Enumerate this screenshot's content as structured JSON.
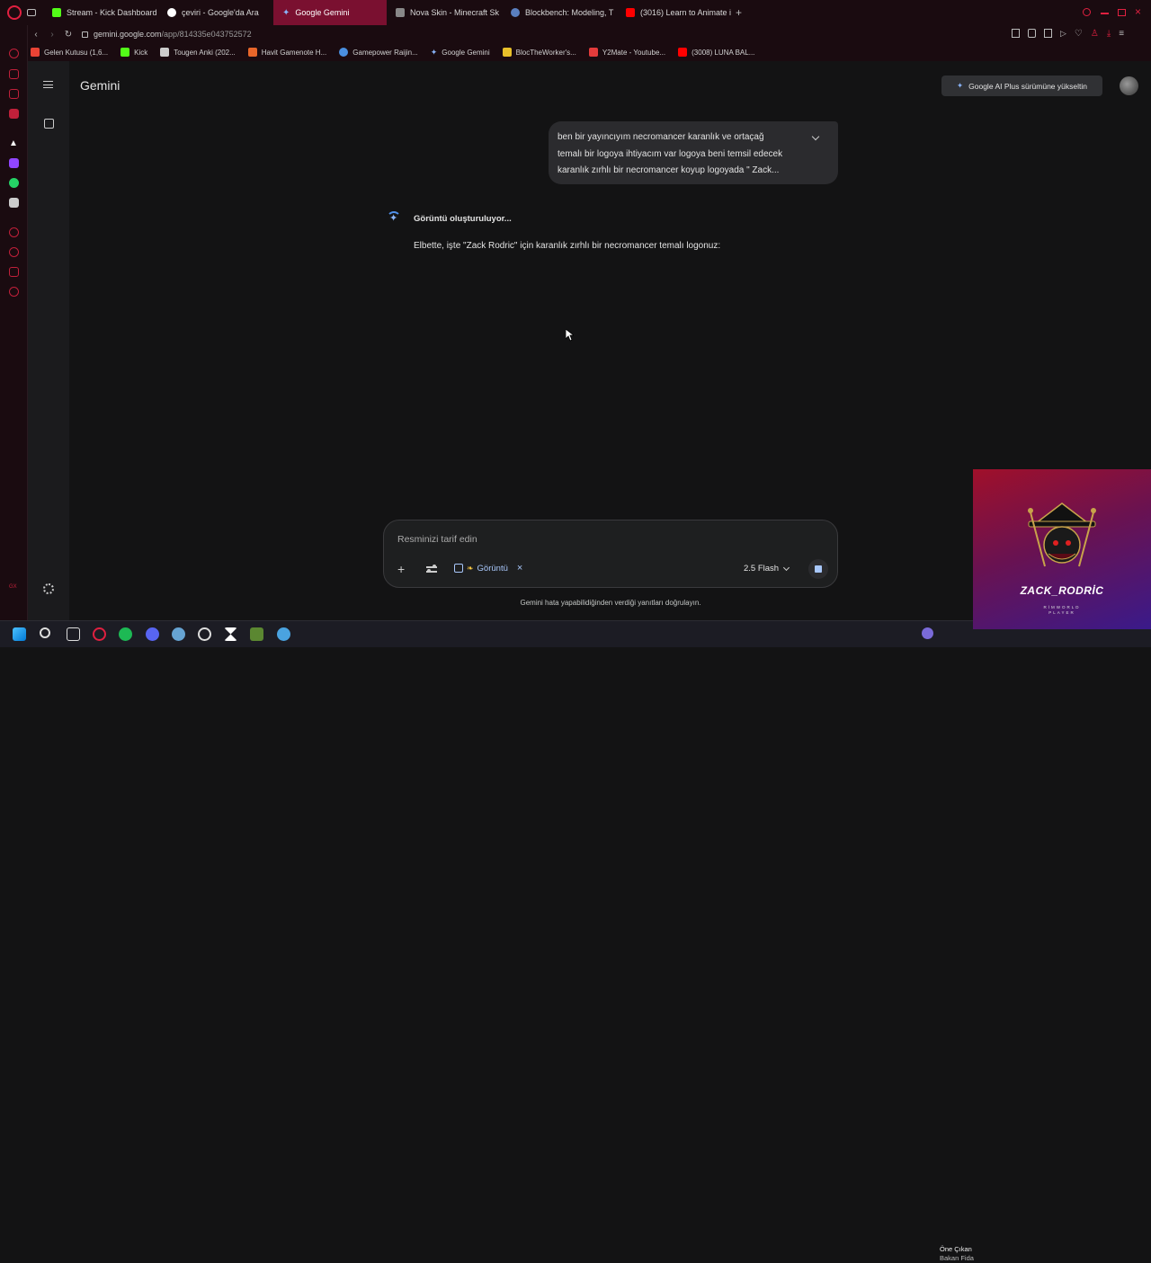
{
  "browser": {
    "tabs": [
      {
        "label": "Stream - Kick Dashboard",
        "color": "#53fc18"
      },
      {
        "label": "çeviri - Google'da Ara",
        "color": "#4285f4"
      },
      {
        "label": "Google Gemini",
        "color": "#8ab4f8",
        "active": true
      },
      {
        "label": "Nova Skin - Minecraft Sk",
        "color": "#888888"
      },
      {
        "label": "Blockbench: Modeling, T",
        "color": "#5a7fbf"
      },
      {
        "label": "(3016) Learn to Animate i",
        "color": "#ff0000"
      }
    ],
    "url_host": "gemini.google.com",
    "url_path": "/app/814335e043752572",
    "bookmarks": [
      {
        "label": "Gelen Kutusu (1,6...",
        "color": "#ea4335"
      },
      {
        "label": "Kick",
        "color": "#53fc18"
      },
      {
        "label": "Tougen Anki (202...",
        "color": "#cccccc"
      },
      {
        "label": "Havit Gamenote H...",
        "color": "#e8662a"
      },
      {
        "label": "Gamepower Raijin...",
        "color": "#4a8fe0"
      },
      {
        "label": "Google Gemini",
        "color": "#8ab4f8"
      },
      {
        "label": "BlocTheWorker's...",
        "color": "#e8c02a"
      },
      {
        "label": "Y2Mate - Youtube...",
        "color": "#e33b3b"
      },
      {
        "label": "(3008) LUNA BAL...",
        "color": "#ff0000"
      }
    ],
    "accent": "#7a1030"
  },
  "gemini": {
    "title": "Gemini",
    "upgrade_label": "Google AI Plus sürümüne yükseltin",
    "user_message_lines": [
      "ben bir yayıncıyım necromancer karanlık ve ortaçağ",
      "temalı bir logoya ihtiyacım var logoya beni temsil edecek",
      "karanlık zırhlı bir necromancer koyup logoyada \" Zack..."
    ],
    "generating_status": "Görüntü oluşturuluyor...",
    "answer": "Elbette, işte \"Zack Rodric\" için karanlık zırhlı bir necromancer temalı logonuz:",
    "composer": {
      "placeholder": "Resminizi tarif edin",
      "tool_chip": "Görüntü",
      "model": "2.5 Flash"
    },
    "disclaimer": "Gemini hata yapabilidiğinden verdiği yanıtları doğrulayın."
  },
  "overlay": {
    "name": "ZACK_RODRİC",
    "sub_1": "RİMWORLD",
    "sub_2": "PLAYER"
  },
  "taskbar": {
    "news_title": "Öne Çıkan",
    "news_sub": "Bakan Fida"
  }
}
